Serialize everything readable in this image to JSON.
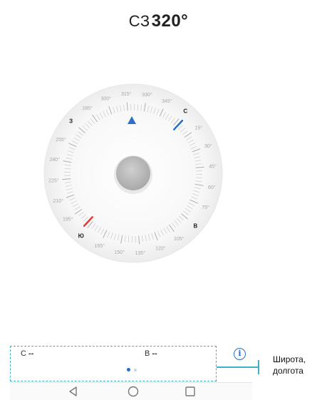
{
  "heading": {
    "direction": "СЗ",
    "degrees": "320°"
  },
  "compass": {
    "bearing_deg": 320,
    "cardinals": {
      "north": "С",
      "east": "В",
      "south": "Ю",
      "west": "З"
    },
    "degree_labels": [
      "15°",
      "30°",
      "45°",
      "60°",
      "75°",
      "105°",
      "120°",
      "135°",
      "150°",
      "165°",
      "195°",
      "210°",
      "225°",
      "240°",
      "255°",
      "285°",
      "300°",
      "315°",
      "330°",
      "345°"
    ],
    "colors": {
      "north_needle": "#1f6fd1",
      "south_needle": "#e53935",
      "pointer": "#2f6fc4",
      "hub": "#bdbdbd"
    }
  },
  "coordinates": {
    "latitude_label": "С",
    "latitude_value": "--",
    "longitude_label": "В",
    "longitude_value": "--"
  },
  "pager": {
    "pages": 2,
    "active": 1
  },
  "info": {
    "icon": "info-icon",
    "symbol": "i"
  },
  "callout": {
    "line1": "Широта,",
    "line2": "долгота"
  },
  "nav": {
    "icons": [
      "back-icon",
      "home-icon",
      "recents-icon"
    ]
  }
}
